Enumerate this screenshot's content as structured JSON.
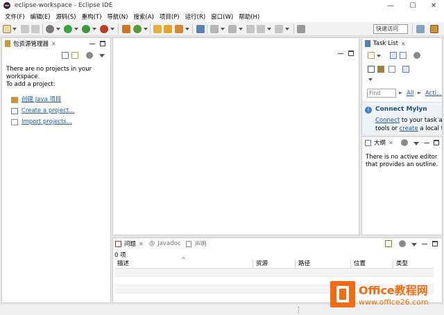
{
  "window": {
    "title": "eclipse-workspace - Eclipse IDE",
    "minimize": "—",
    "maximize": "☐",
    "close": "✕"
  },
  "menu": [
    "文件(F)",
    "编辑(E)",
    "源码(S)",
    "重构(T)",
    "导航(N)",
    "搜索(A)",
    "项目(P)",
    "运行(R)",
    "窗口(W)",
    "帮助(H)"
  ],
  "toolbar": {
    "quick_access": "快速访问"
  },
  "package_explorer": {
    "tab_title": "包资源管理器",
    "close": "✕",
    "message_line1": "There are no projects in your",
    "message_line2": "workspace.",
    "message_line3": "To add a project:",
    "links": [
      "创建 Java 项目",
      "Create a project...",
      "Import projects..."
    ]
  },
  "task_list": {
    "tab_title": "Task List",
    "close": "✕",
    "find_placeholder": "Find",
    "all": "All",
    "activate": "Acti...",
    "separator": "►",
    "mylyn_title": "Connect Mylyn",
    "mylyn_connect": "Connect",
    "mylyn_text1": " to your task and",
    "mylyn_text2": "tools or ",
    "mylyn_create": "create",
    "mylyn_text3": " a local tas"
  },
  "outline": {
    "tab_title": "大纲",
    "close": "✕",
    "message_line1": "There is no active editor",
    "message_line2": "that provides an outline."
  },
  "problems": {
    "tabs": {
      "problems": "问题",
      "problems_close": "✕",
      "javadoc_at": "@",
      "javadoc": "Javadoc",
      "declaration": "声明"
    },
    "count": "0 项",
    "columns": [
      "描述",
      "资源",
      "路径",
      "位置",
      "类型"
    ],
    "sort_indicator": "^"
  },
  "watermark": {
    "brand": "Office教程网",
    "url": "www.office26.com"
  },
  "colors": {
    "accent_orange": "#f26b10",
    "link_blue": "#1a5aa6",
    "panel_border": "#cfcfcf"
  }
}
